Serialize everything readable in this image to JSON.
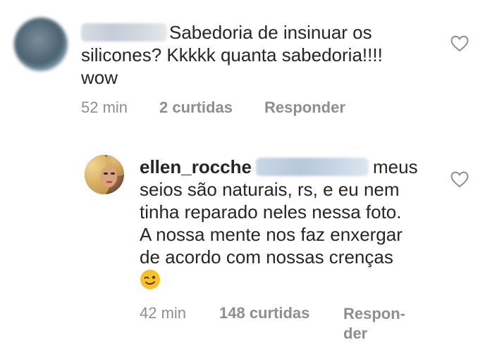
{
  "comments": [
    {
      "avatar_icon": "blurred-avatar",
      "username_hidden": true,
      "text_lines": [
        "Sabedoria de insinuar os",
        "silicones? Kkkkk quanta sabedoria!!!!",
        "wow"
      ],
      "time": "52 min",
      "likes": "2 curtidas",
      "reply_label": "Responder",
      "like_icon": "heart-outline-icon"
    },
    {
      "avatar_icon": "profile-avatar",
      "username": "ellen_rocche",
      "mention_hidden": true,
      "text_lines": [
        "meus",
        "seios são naturais, rs, e eu nem",
        "tinha reparado neles nessa foto.",
        "A nossa mente nos faz enxergar",
        "de acordo com nossas crenças"
      ],
      "emoji_icon": "winking-face-emoji",
      "time": "42 min",
      "likes": "148 curtidas",
      "reply_label_lines": [
        "Respon-",
        "der"
      ],
      "like_icon": "heart-outline-icon"
    }
  ],
  "colors": {
    "text": "#262626",
    "meta": "#8e8e8e",
    "background": "#ffffff"
  }
}
